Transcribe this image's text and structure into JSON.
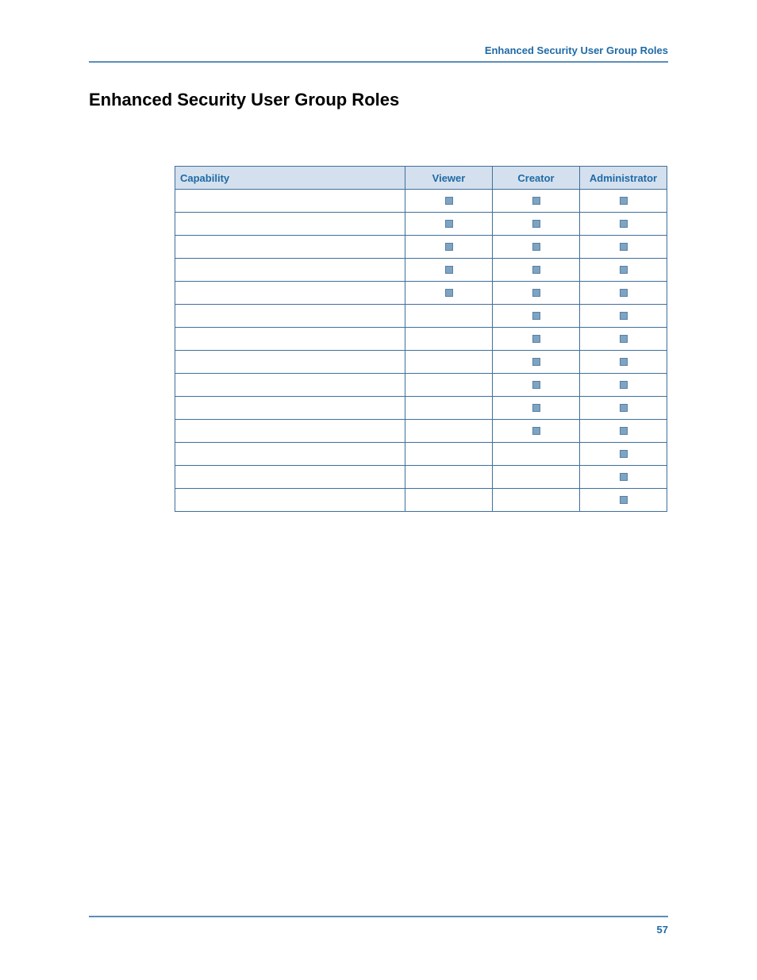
{
  "header": {
    "running_title": "Enhanced Security User Group Roles"
  },
  "title": "Enhanced Security User Group Roles",
  "table": {
    "columns": [
      "Capability",
      "Viewer",
      "Creator",
      "Administrator"
    ],
    "rows": [
      {
        "capability": "",
        "viewer": true,
        "creator": true,
        "administrator": true
      },
      {
        "capability": "",
        "viewer": true,
        "creator": true,
        "administrator": true
      },
      {
        "capability": "",
        "viewer": true,
        "creator": true,
        "administrator": true
      },
      {
        "capability": "",
        "viewer": true,
        "creator": true,
        "administrator": true
      },
      {
        "capability": "",
        "viewer": true,
        "creator": true,
        "administrator": true
      },
      {
        "capability": "",
        "viewer": false,
        "creator": true,
        "administrator": true
      },
      {
        "capability": "",
        "viewer": false,
        "creator": true,
        "administrator": true
      },
      {
        "capability": "",
        "viewer": false,
        "creator": true,
        "administrator": true
      },
      {
        "capability": "",
        "viewer": false,
        "creator": true,
        "administrator": true
      },
      {
        "capability": "",
        "viewer": false,
        "creator": true,
        "administrator": true
      },
      {
        "capability": "",
        "viewer": false,
        "creator": true,
        "administrator": true
      },
      {
        "capability": "",
        "viewer": false,
        "creator": false,
        "administrator": true
      },
      {
        "capability": "",
        "viewer": false,
        "creator": false,
        "administrator": true
      },
      {
        "capability": "",
        "viewer": false,
        "creator": false,
        "administrator": true
      }
    ]
  },
  "footer": {
    "page_number": "57"
  }
}
